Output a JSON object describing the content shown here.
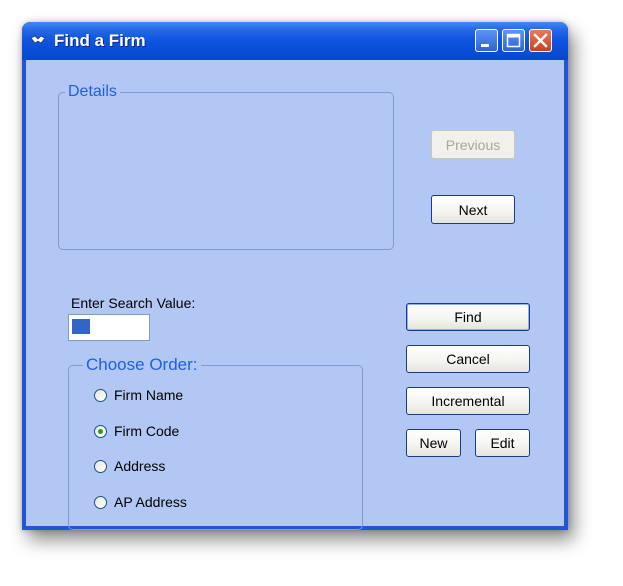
{
  "window": {
    "title": "Find a Firm",
    "controls": [
      "minimize-icon",
      "maximize-icon",
      "close-icon"
    ]
  },
  "details": {
    "legend": "Details"
  },
  "buttons": {
    "previous": "Previous",
    "next": "Next",
    "find": "Find",
    "cancel": "Cancel",
    "incremental": "Incremental",
    "new": "New",
    "edit": "Edit"
  },
  "search": {
    "label": "Enter Search Value:",
    "value": ""
  },
  "order": {
    "legend": "Choose Order:",
    "options": [
      {
        "label": "Firm Name",
        "checked": false
      },
      {
        "label": "Firm Code",
        "checked": true
      },
      {
        "label": "Address",
        "checked": false
      },
      {
        "label": "AP Address",
        "checked": false
      }
    ]
  },
  "colors": {
    "titlebar": "#0a4ed9",
    "client_bg": "#b3c7f4",
    "legend_text": "#1f5fe0",
    "radio_dot": "#21a121",
    "close_button": "#c9411d"
  }
}
